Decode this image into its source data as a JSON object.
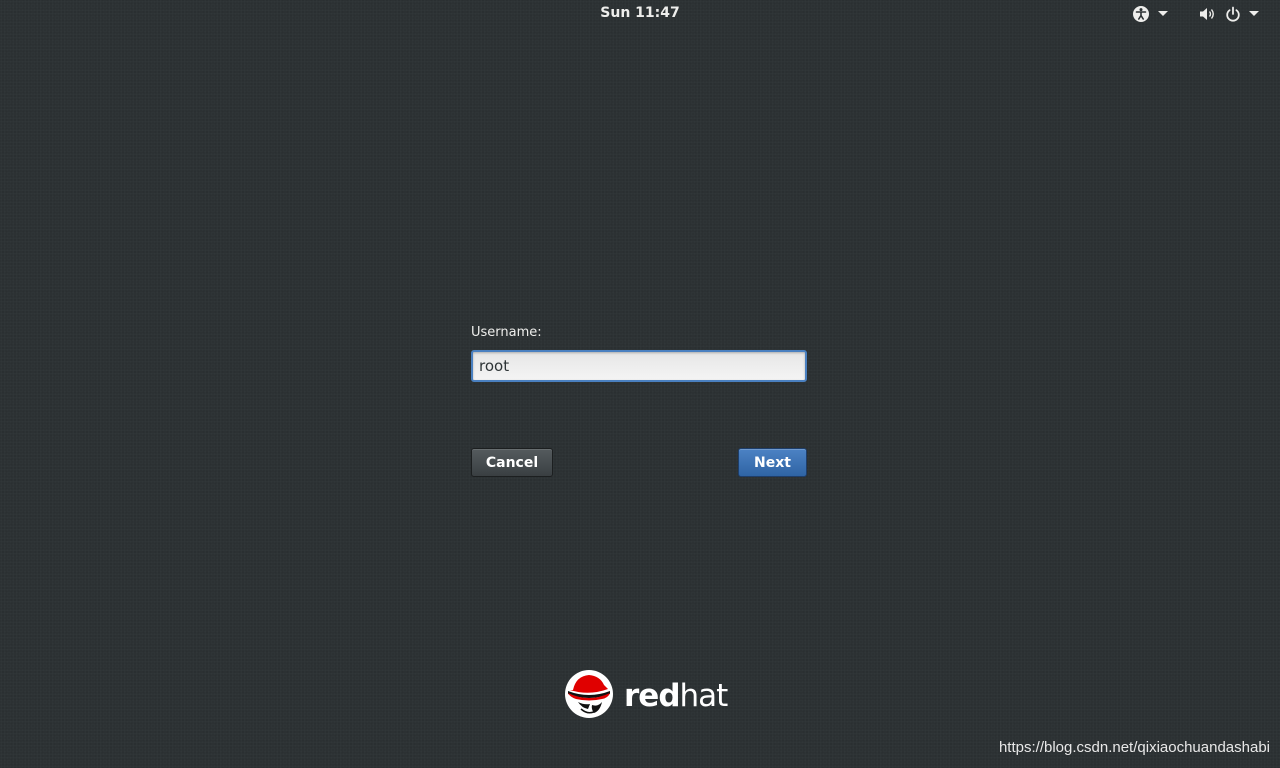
{
  "topbar": {
    "clock": "Sun 11:47",
    "icons": [
      "accessibility-icon",
      "dropdown-arrow-icon",
      "volume-icon",
      "power-icon",
      "dropdown-arrow-icon"
    ]
  },
  "login": {
    "username_label": "Username:",
    "username_value": "root",
    "cancel_label": "Cancel",
    "next_label": "Next"
  },
  "branding": {
    "logo_text_bold": "red",
    "logo_text_light": "hat"
  },
  "watermark": "https://blog.csdn.net/qixiaochuandashabi",
  "colors": {
    "background": "#2c3133",
    "focus_border": "#4a80c0",
    "next_button": "#3a6fb0",
    "logo_red": "#e00000"
  }
}
